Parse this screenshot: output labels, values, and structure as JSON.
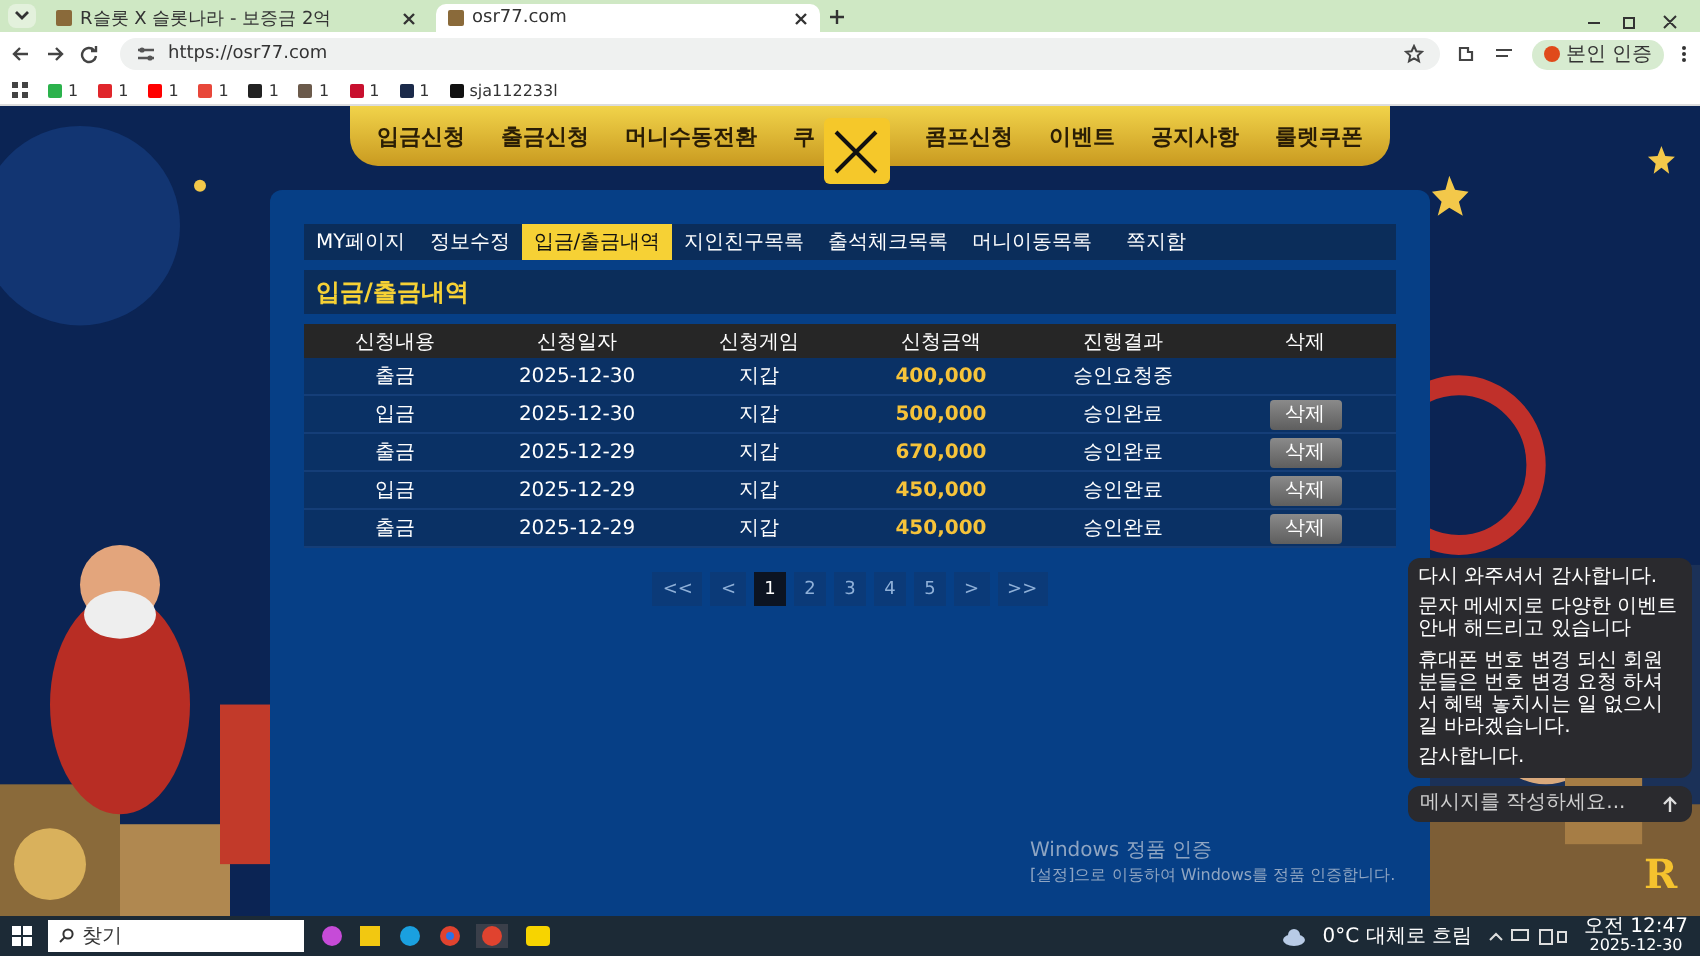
{
  "browser": {
    "tabs": [
      {
        "title": "R슬롯 X 슬롯나라 - 보증금 2억",
        "selected": false
      },
      {
        "title": "osr77.com",
        "selected": true
      }
    ],
    "url": "https://osr77.com",
    "profile_button": "본인 인증",
    "bookmarks": [
      {
        "label": "1",
        "color": "#2bb24c"
      },
      {
        "label": "1",
        "color": "#e0262b"
      },
      {
        "label": "1",
        "color": "#ff0000"
      },
      {
        "label": "1",
        "color": "#e8473a"
      },
      {
        "label": "1",
        "color": "#222222"
      },
      {
        "label": "1",
        "color": "#6b5a4b"
      },
      {
        "label": "1",
        "color": "#c8102e"
      },
      {
        "label": "1",
        "color": "#1b2a4a"
      },
      {
        "label": "sja112233l",
        "color": "#111111"
      }
    ]
  },
  "site": {
    "nav": [
      "입금신청",
      "출금신청",
      "머니수동전환",
      "쿠",
      "콤프신청",
      "이벤트",
      "공지사항",
      "룰렛쿠폰"
    ],
    "tabs": [
      {
        "label": "MY페이지",
        "selected": false
      },
      {
        "label": "정보수정",
        "selected": false
      },
      {
        "label": "입금/출금내역",
        "selected": true
      },
      {
        "label": "지인친구목록",
        "selected": false
      },
      {
        "label": "출석체크목록",
        "selected": false
      },
      {
        "label": "머니이동목록",
        "selected": false
      },
      {
        "label": "쪽지함",
        "selected": false
      }
    ],
    "section_title": "입금/출금내역",
    "table": {
      "columns": [
        "신청내용",
        "신청일자",
        "신청게임",
        "신청금액",
        "진행결과",
        "삭제"
      ],
      "rows": [
        {
          "cells": [
            "출금",
            "2025-12-30",
            "지갑",
            "400,000",
            "승인요청중"
          ],
          "deletable": false
        },
        {
          "cells": [
            "입금",
            "2025-12-30",
            "지갑",
            "500,000",
            "승인완료"
          ],
          "deletable": true,
          "button": "삭제"
        },
        {
          "cells": [
            "출금",
            "2025-12-29",
            "지갑",
            "670,000",
            "승인완료"
          ],
          "deletable": true,
          "button": "삭제"
        },
        {
          "cells": [
            "입금",
            "2025-12-29",
            "지갑",
            "450,000",
            "승인완료"
          ],
          "deletable": true,
          "button": "삭제"
        },
        {
          "cells": [
            "출금",
            "2025-12-29",
            "지갑",
            "450,000",
            "승인완료"
          ],
          "deletable": true,
          "button": "삭제"
        }
      ]
    },
    "pagination": [
      {
        "label": "<<",
        "selected": false
      },
      {
        "label": "<",
        "selected": false
      },
      {
        "label": "1",
        "selected": true
      },
      {
        "label": "2",
        "selected": false
      },
      {
        "label": "3",
        "selected": false
      },
      {
        "label": "4",
        "selected": false
      },
      {
        "label": "5",
        "selected": false
      },
      {
        "label": ">",
        "selected": false
      },
      {
        "label": ">>",
        "selected": false
      }
    ],
    "chat": {
      "messages": [
        "다시 와주셔서 감사합니다.",
        "문자 메세지로 다양한 이벤트 안내 해드리고 있습니다",
        "휴대폰 번호 변경 되신 회원 분들은 번호 변경 요청 하셔서 혜택 놓치시는 일 없으시길 바라겠습니다.",
        "감사합니다."
      ],
      "placeholder": "메시지를 작성하세요..."
    },
    "floating_badge": "R",
    "activation_notice": [
      "Windows 정품 인증",
      "[설정]으로 이동하여 Windows를 정품 인증합니다."
    ]
  },
  "taskbar": {
    "search_placeholder": "찾기",
    "weather": "0°C 대체로 흐림",
    "time": "오전 12:47",
    "date": "2025-12-30"
  }
}
